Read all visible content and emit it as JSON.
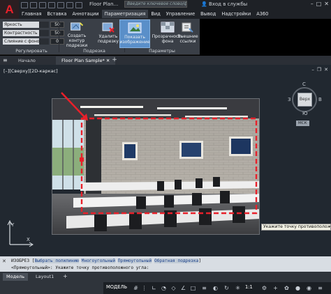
{
  "app": {
    "logo_letter": "A",
    "doc_title": "Floor Plan...",
    "search_placeholder": "Введите ключевое слово/фразу",
    "signin": "Вход в службы"
  },
  "menu": [
    "Главная",
    "Вставка",
    "Аннотации",
    "Параметризация",
    "Вид",
    "Управление",
    "Вывод",
    "Надстройки",
    "A360"
  ],
  "ribbon": {
    "adjust": [
      {
        "label": "Яркость",
        "value": "50"
      },
      {
        "label": "Контрастность",
        "value": "50"
      },
      {
        "label": "Слияние с фоном",
        "value": "0"
      }
    ],
    "panel_adjust": "Регулировать",
    "panel_clip": "Подрезка",
    "panel_options": "Параметры",
    "buttons": [
      {
        "label1": "Создать контур",
        "label2": "подрезки"
      },
      {
        "label1": "Удалить",
        "label2": "подрезку"
      },
      {
        "label1": "Показать",
        "label2": "изображение"
      },
      {
        "label1": "Прозрачность",
        "label2": "фона"
      },
      {
        "label1": "Внешние",
        "label2": "ссылки"
      }
    ]
  },
  "tabs": {
    "start": "Начало",
    "active": "Floor Plan Sample*"
  },
  "viewport": {
    "view_label": "[–][Сверху][2D-каркас]",
    "viewcube": {
      "face": "Верх",
      "n": "С",
      "s": "Ю",
      "w": "З",
      "e": "В"
    },
    "wcs": "МСК",
    "tooltip": "Укажите точку противоположного угла:"
  },
  "cmdline": {
    "line1_prefix": "ИЗОБРЕЗ",
    "options": [
      "Выбрать полилинию",
      "Многоугольный",
      "Прямоугольный",
      "Обратная подрезка"
    ],
    "line2": "<Прямоугольный>: Укажите точку противоположного угла:"
  },
  "status": {
    "tab_model": "Модель",
    "tab_layout": "Layout1",
    "mode": "МОДЕЛЬ",
    "scale": "1:1"
  },
  "colors": {
    "accent": "#5a8fc9",
    "clip_rect": "#e8202a",
    "logo": "#e8202a"
  }
}
